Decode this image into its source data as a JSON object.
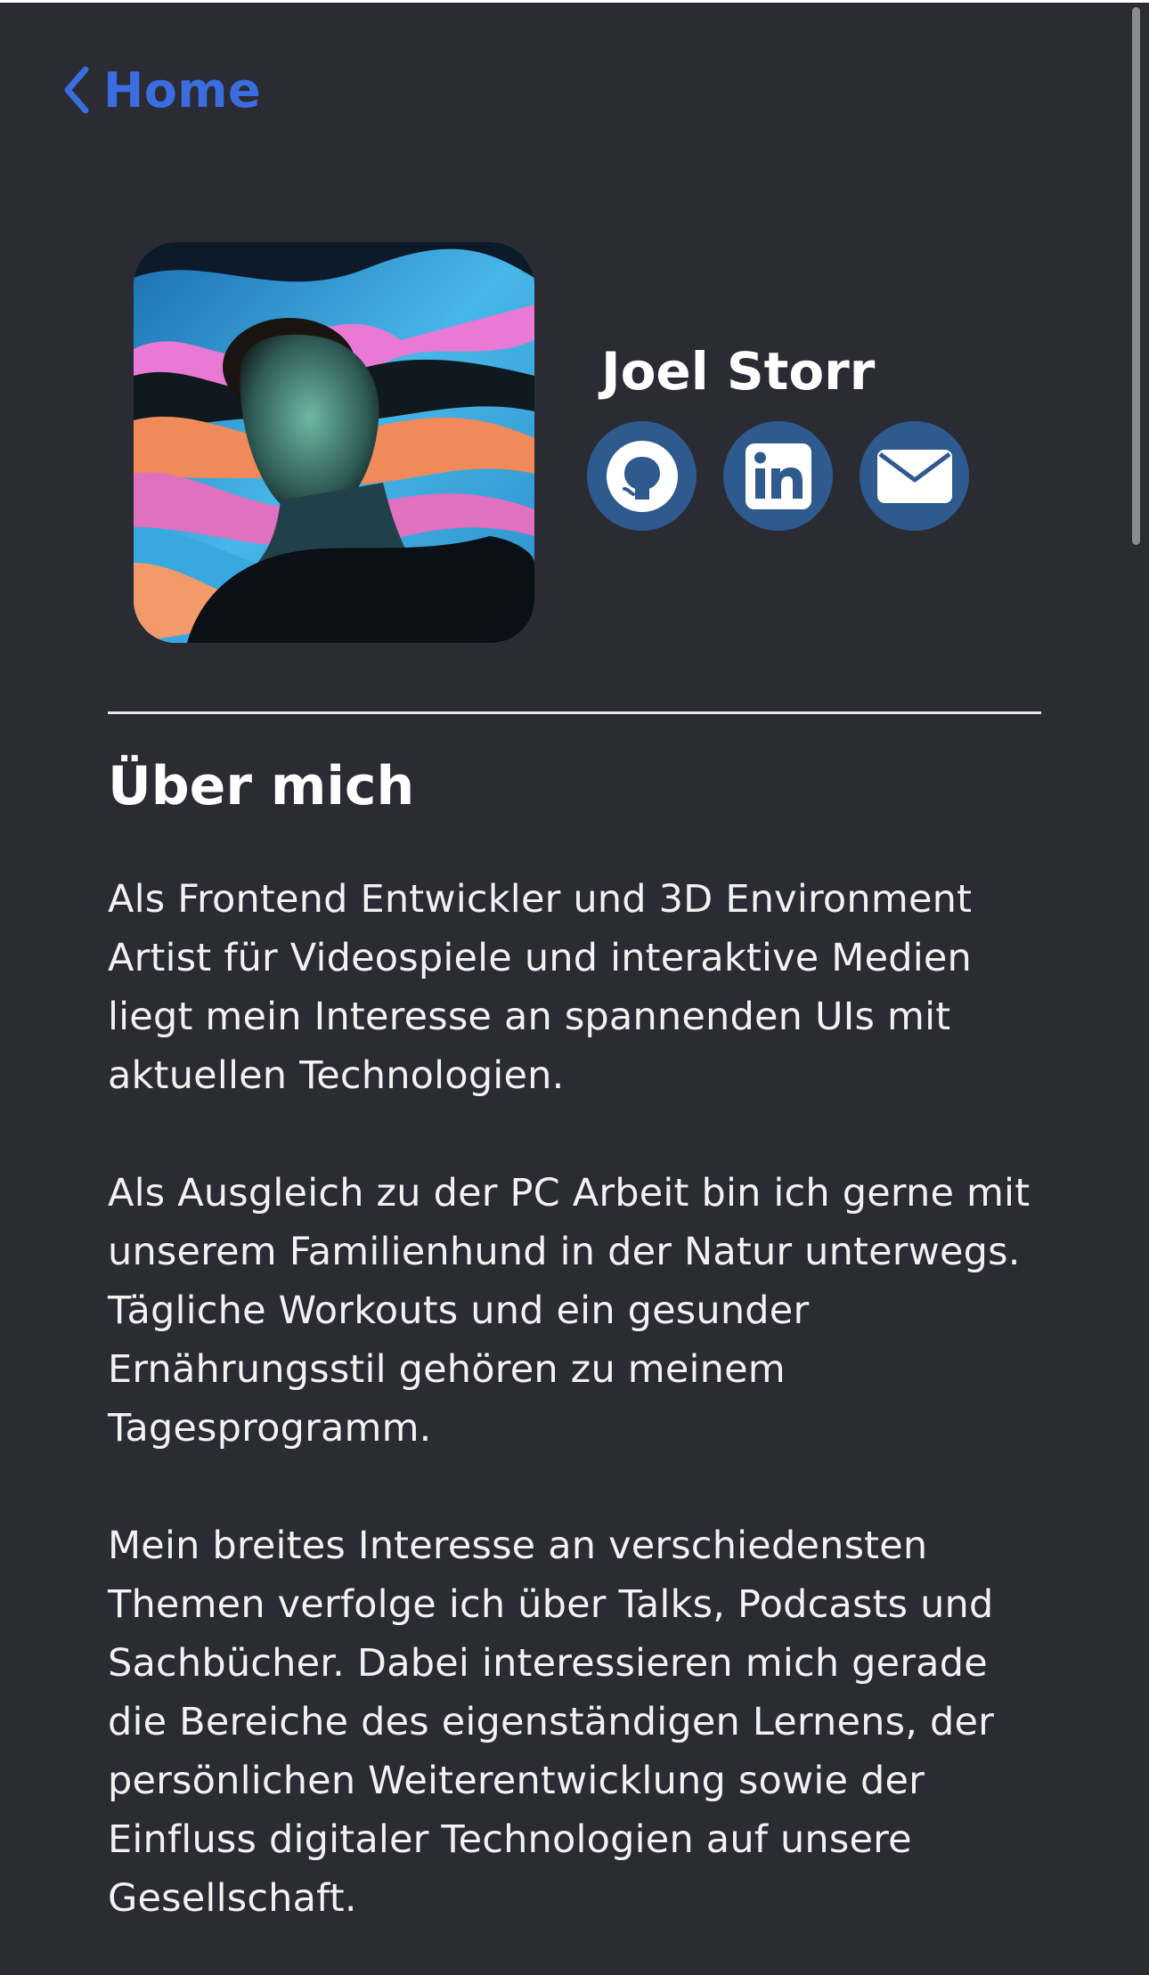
{
  "nav": {
    "back_label": "Home"
  },
  "profile": {
    "name": "Joel Storr",
    "socials": [
      {
        "icon": "github-icon",
        "label": "GitHub"
      },
      {
        "icon": "linkedin-icon",
        "label": "LinkedIn"
      },
      {
        "icon": "mail-icon",
        "label": "E-Mail"
      }
    ]
  },
  "about": {
    "heading": "Über mich",
    "paragraphs": [
      "Als Frontend Entwickler und 3D Environment Artist für Videospiele und interaktive Medien liegt mein Interesse an spannenden UIs mit aktuellen Technologien.",
      "Als Ausgleich zu der PC Arbeit bin ich gerne mit unserem Familienhund in der Natur unterwegs. Tägliche Workouts und ein gesunder Ernährungsstil gehören zu meinem Tagesprogramm.",
      "Mein breites Interesse an verschiedensten Themen verfolge ich über Talks, Podcasts und Sachbücher. Dabei interessieren mich gerade die Bereiche des eigenständigen Lernens, der persönlichen Weiterentwicklung sowie der Einfluss digitaler Technologien auf unsere Gesellschaft."
    ]
  },
  "colors": {
    "background": "#2a2b33",
    "accent": "#3a6ee0",
    "social_circle": "#2e5a8e"
  }
}
